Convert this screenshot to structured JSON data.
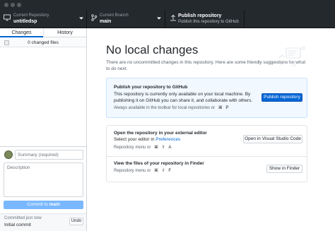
{
  "toolbar": {
    "repository": {
      "label": "Current Repository",
      "value": "untitledsp",
      "icon": "monitor-icon"
    },
    "branch": {
      "label": "Current Branch",
      "value": "main",
      "icon": "branch-icon"
    },
    "publish": {
      "label": "Publish repository",
      "sub": "Publish this repository to GitHub",
      "icon": "upload-icon"
    }
  },
  "sidebar": {
    "tabs": [
      {
        "label": "Changes",
        "active": true
      },
      {
        "label": "History",
        "active": false
      }
    ],
    "changed_files": "0 changed files",
    "summary_placeholder": "Summary (required)",
    "description_placeholder": "Description",
    "commit_prefix": "Commit to",
    "commit_branch": "main",
    "last_commit_time": "Committed just now",
    "last_commit_message": "Initial commit",
    "undo_label": "Undo"
  },
  "main": {
    "title": "No local changes",
    "subtitle": "There are no uncommitted changes in this repository. Here are some friendly suggestions for what to do next.",
    "publish_card": {
      "title": "Publish your repository to GitHub",
      "text": "This repository is currently only available on your local machine. By publishing it on GitHub you can share it, and collaborate with others.",
      "hint": "Always available in the toolbar for local repositories or",
      "keys": [
        "⌘",
        "P"
      ],
      "button": "Publish repository"
    },
    "editor_card": {
      "title": "Open the repository in your external editor",
      "text_prefix": "Select your editor in",
      "text_link": "Preferences",
      "hint": "Repository menu or",
      "keys": [
        "⌘",
        "⇧",
        "A"
      ],
      "button": "Open in Visual Studio Code"
    },
    "finder_card": {
      "title": "View the files of your repository in Finder",
      "hint": "Repository menu or",
      "keys": [
        "⌘",
        "⇧",
        "F"
      ],
      "button": "Show in Finder"
    }
  },
  "colors": {
    "accent": "#0366d6",
    "toolbar": "#24292e",
    "commit_button": "#79b8ff"
  }
}
